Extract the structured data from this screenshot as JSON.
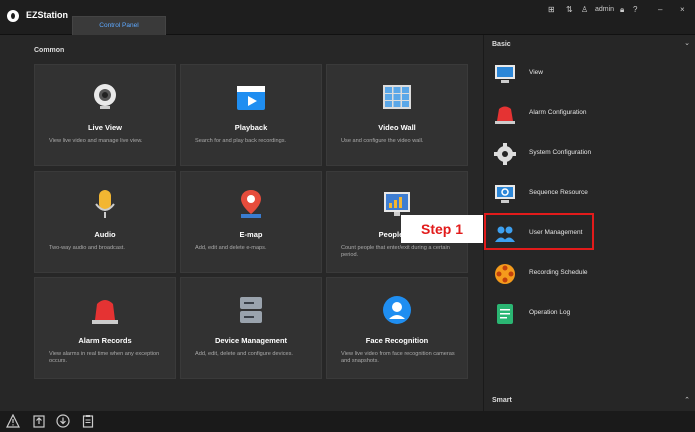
{
  "app": {
    "title": "EZStation"
  },
  "tabs": [
    {
      "label": "Control Panel"
    }
  ],
  "titlebar": {
    "user": "admin",
    "minimize": "–",
    "close": "×"
  },
  "main": {
    "section_label": "Common",
    "cards": [
      {
        "title": "Live View",
        "desc": "View live video and manage live view."
      },
      {
        "title": "Playback",
        "desc": "Search for and play back recordings."
      },
      {
        "title": "Video Wall",
        "desc": "Use and configure the video wall."
      },
      {
        "title": "Audio",
        "desc": "Two-way audio and broadcast."
      },
      {
        "title": "E-map",
        "desc": "Add, edit and delete e-maps."
      },
      {
        "title": "People Co",
        "desc": "Count people that enter/exit during a certain period."
      },
      {
        "title": "Alarm Records",
        "desc": "View alarms in real time when any exception occurs."
      },
      {
        "title": "Device Management",
        "desc": "Add, edit, delete and configure devices."
      },
      {
        "title": "Face Recognition",
        "desc": "View live video from face recognition cameras and snapshots."
      }
    ]
  },
  "sidebar": {
    "basic_label": "Basic",
    "smart_label": "Smart",
    "items": [
      {
        "label": "View"
      },
      {
        "label": "Alarm Configuration"
      },
      {
        "label": "System Configuration"
      },
      {
        "label": "Sequence Resource"
      },
      {
        "label": "User Management"
      },
      {
        "label": "Recording Schedule"
      },
      {
        "label": "Operation Log"
      }
    ]
  },
  "annotation": {
    "step_label": "Step 1"
  },
  "colors": {
    "accent": "#5ea9ff",
    "highlight": "#e21b1b"
  }
}
